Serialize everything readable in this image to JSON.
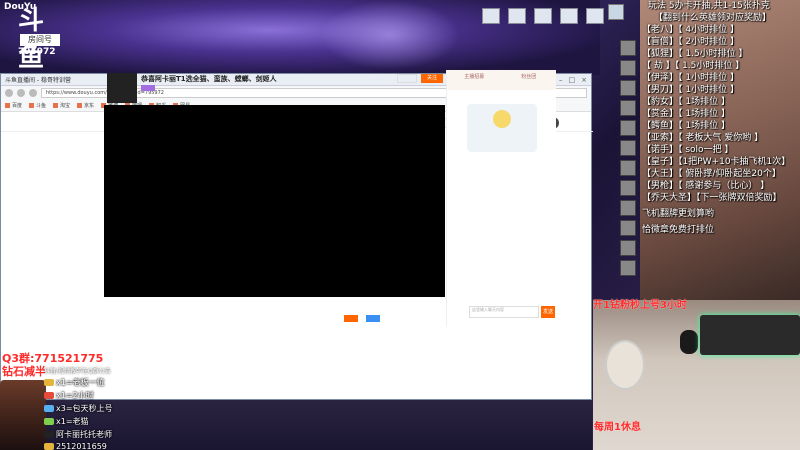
{
  "logo": {
    "brand": "DouYu",
    "big_text": "斗鱼",
    "room_label": "房间号",
    "room_number": "795972"
  },
  "browser": {
    "tab_title": "斗鱼直播间 - 稳哥特训营",
    "url": "https://www.douyu.com/topic/Wok?rid=795972",
    "bookmarks": [
      "百度",
      "斗鱼",
      "淘宝",
      "京东",
      "微博",
      "哔哩",
      "知乎",
      "网易"
    ],
    "site_nav": [
      "首页",
      "直播",
      "分类",
      "视频",
      "游戏",
      "鱼吧"
    ],
    "active_nav_index": 1,
    "room_title": "恭喜阿卡丽T1选全猫、蛮族、螳螂、剑姬人",
    "follow_label": "关注",
    "chat_tabs": [
      "主播招募",
      "粉丝团"
    ],
    "chat_input_placeholder": "这里输入聊天内容",
    "send_label": "发送"
  },
  "overlay_left": {
    "qq_group": "Q3群:771521775",
    "diamond": "钻石减半",
    "gifts_header": "抖音/视频教学在Q群公告",
    "gifts": [
      {
        "icon": "gold",
        "text": "x1=老板一位"
      },
      {
        "icon": "red",
        "text": "x1=2小时"
      },
      {
        "icon": "blue",
        "text": "x3=包天秒上号"
      },
      {
        "icon": "green",
        "text": "x1=老猫"
      },
      {
        "icon": "black",
        "text": "阿卡丽托托老师"
      },
      {
        "icon": "gold",
        "text": "2512011659"
      }
    ]
  },
  "overlay_right": {
    "header1": "玩法     5办卡开抽,共1-15张扑克",
    "header2": "【翻到什么英雄领对应奖励】",
    "rules": [
      "【老八】【      4小时排位      】",
      "【盲僧】【      2小时排位      】",
      "【狐狸】【   1.5小时排位      】",
      "【  劫  】【   1.5小时排位     】",
      "【伊泽】【     1小时排位       】",
      "【男刀】【     1小时排位       】",
      "【豹女】【       1场排位       】",
      "【赏金】【       1场排位       】",
      "【鳄鱼】【       1场排位       】",
      "【亚索】【   老板大气  爱你哟  】",
      "【诺手】【      solo一把       】",
      "【皇子】【1把PW+10卡抽飞机1次】",
      "【大王】【  俯卧撑/仰卧起坐20个】",
      "【男枪】【     感谢参与（比心） 】",
      "【乔天大圣】【下一张牌双倍奖励】"
    ],
    "notes": [
      "飞机翻牌更划算哟",
      "恰微章免费打排位"
    ],
    "promo": "开1钻粉秒上号3小时",
    "weekly": "每周1休息"
  },
  "colors": {
    "accent": "#ff6600",
    "overlay_red": "#ff2a2a",
    "badge_purple": "#a26de0"
  }
}
